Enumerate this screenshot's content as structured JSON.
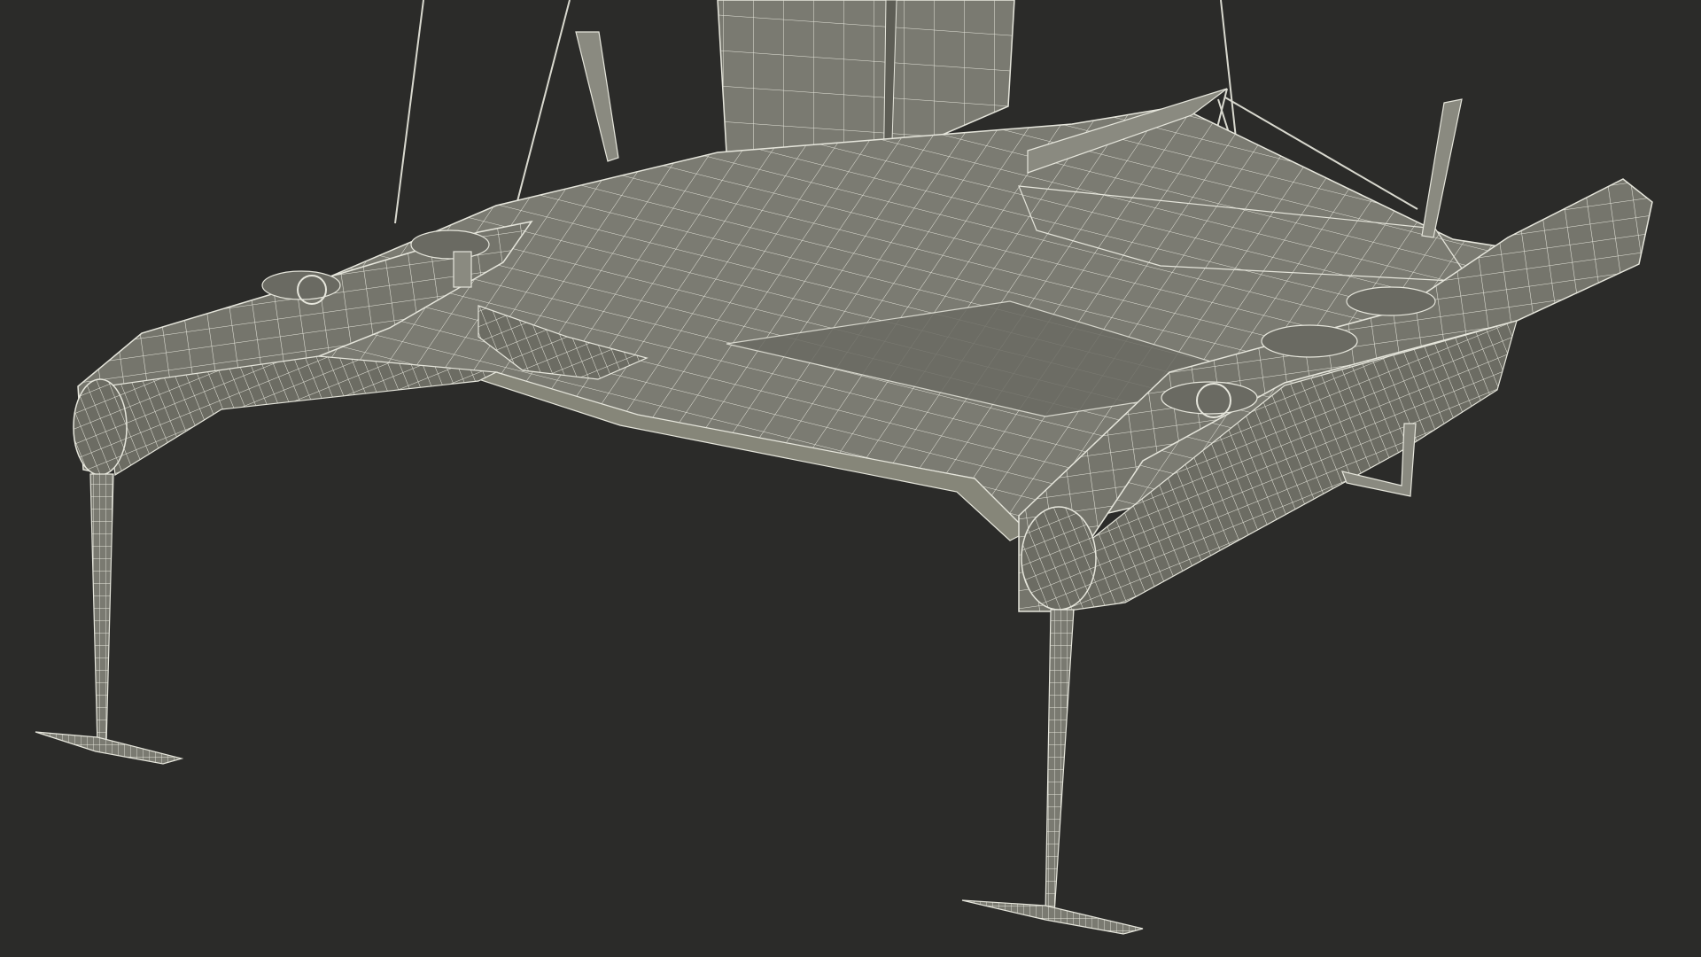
{
  "scene": {
    "subject": "wireframe-catamaran-hull-foils",
    "background_color": "#2b2b29",
    "surface_color": "#75756c",
    "wire_color": "#e6e6dc",
    "shade_color": "#5d5d55",
    "light_color": "#8a8a80"
  }
}
